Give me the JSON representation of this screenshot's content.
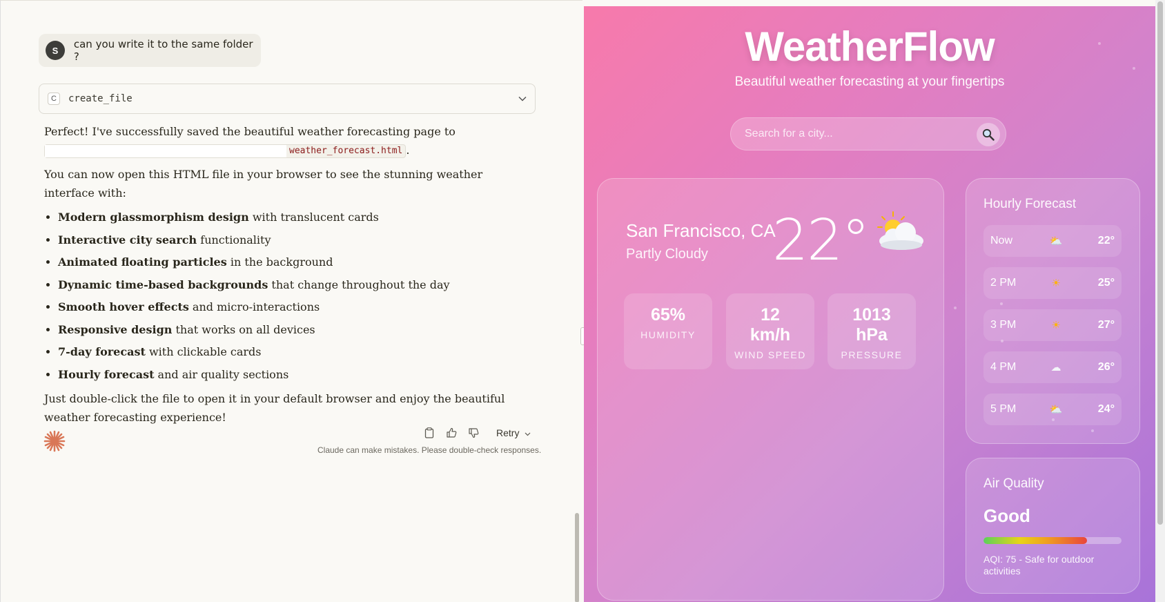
{
  "chat": {
    "user": {
      "avatar_initial": "S",
      "message": "can you write it to the same folder ?"
    },
    "tool_call": {
      "icon_letter": "C",
      "name": "create_file"
    },
    "response": {
      "intro": "Perfect! I've successfully saved the beautiful weather forecasting page to",
      "file_path": "weather_forecast.html",
      "intro_end": ".",
      "open_text": "You can now open this HTML file in your browser to see the stunning weather interface with:",
      "features": [
        {
          "bold": "Modern glassmorphism design",
          "rest": " with translucent cards"
        },
        {
          "bold": "Interactive city search",
          "rest": " functionality"
        },
        {
          "bold": "Animated floating particles",
          "rest": " in the background"
        },
        {
          "bold": "Dynamic time-based backgrounds",
          "rest": " that change throughout the day"
        },
        {
          "bold": "Smooth hover effects",
          "rest": " and micro-interactions"
        },
        {
          "bold": "Responsive design",
          "rest": " that works on all devices"
        },
        {
          "bold": "7-day forecast",
          "rest": " with clickable cards"
        },
        {
          "bold": "Hourly forecast",
          "rest": " and air quality sections"
        }
      ],
      "closing": "Just double-click the file to open it in your default browser and enjoy the beautiful weather forecasting experience!"
    },
    "actions": {
      "retry_label": "Retry"
    },
    "disclaimer": "Claude can make mistakes. Please double-check responses."
  },
  "weather": {
    "title": "WeatherFlow",
    "subtitle": "Beautiful weather forecasting at your fingertips",
    "search": {
      "placeholder": "Search for a city..."
    },
    "current": {
      "city": "San Francisco, CA",
      "condition": "Partly Cloudy",
      "temperature": "22°",
      "icon": "partly-cloudy-icon",
      "stats": [
        {
          "value": "65%",
          "label": "HUMIDITY"
        },
        {
          "value": "12\nkm/h",
          "label": "WIND SPEED"
        },
        {
          "value": "1013\nhPa",
          "label": "PRESSURE"
        }
      ]
    },
    "hourly": {
      "title": "Hourly Forecast",
      "items": [
        {
          "time": "Now",
          "icon": "partly-cloudy-icon",
          "temp": "22°"
        },
        {
          "time": "2 PM",
          "icon": "sun-icon",
          "temp": "25°"
        },
        {
          "time": "3 PM",
          "icon": "sun-icon",
          "temp": "27°"
        },
        {
          "time": "4 PM",
          "icon": "cloud-icon",
          "temp": "26°"
        },
        {
          "time": "5 PM",
          "icon": "partly-cloudy-icon",
          "temp": "24°"
        }
      ]
    },
    "air_quality": {
      "title": "Air Quality",
      "level": "Good",
      "fill_fraction": 0.75,
      "description": "AQI: 75 - Safe for outdoor activities"
    },
    "colors": {
      "bg_start": "#f77aab",
      "bg_end": "#a873d9",
      "claude_accent": "#d97757"
    }
  }
}
